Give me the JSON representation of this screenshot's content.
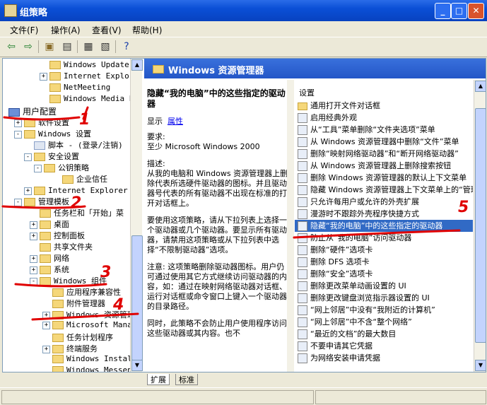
{
  "window": {
    "title": "组策略"
  },
  "menu": {
    "items": [
      "文件(F)",
      "操作(A)",
      "查看(V)",
      "帮助(H)"
    ]
  },
  "tree": {
    "rows": [
      {
        "label": "Windows Update",
        "indent": 66,
        "folder": true
      },
      {
        "label": "Internet Explor",
        "indent": 66,
        "folder": true,
        "expander": "+"
      },
      {
        "label": "NetMeeting",
        "indent": 66,
        "folder": true
      },
      {
        "label": "Windows Media Pl",
        "indent": 66,
        "folder": true
      },
      {
        "label": "用户配置",
        "indent": 8,
        "folder": false,
        "user": true
      },
      {
        "label": "软件设置",
        "indent": 30,
        "folder": true,
        "expander": "+"
      },
      {
        "label": "Windows 设置",
        "indent": 30,
        "folder": true,
        "expander": "-"
      },
      {
        "label": "脚本 - (登录/注销)",
        "indent": 44,
        "folder": false
      },
      {
        "label": "安全设置",
        "indent": 44,
        "folder": true,
        "expander": "-"
      },
      {
        "label": "公钥策略",
        "indent": 58,
        "folder": true,
        "expander": "-"
      },
      {
        "label": "企业信任",
        "indent": 84,
        "folder": true
      },
      {
        "label": "Internet Explorer 维",
        "indent": 44,
        "folder": true,
        "expander": "+"
      },
      {
        "label": "管理模板",
        "indent": 30,
        "folder": true,
        "expander": "-"
      },
      {
        "label": "任务栏和「开始」菜",
        "indent": 52,
        "folder": true
      },
      {
        "label": "桌面",
        "indent": 52,
        "folder": true,
        "expander": "+"
      },
      {
        "label": "控制面板",
        "indent": 52,
        "folder": true,
        "expander": "+"
      },
      {
        "label": "共享文件夹",
        "indent": 52,
        "folder": true
      },
      {
        "label": "网络",
        "indent": 52,
        "folder": true,
        "expander": "+"
      },
      {
        "label": "系统",
        "indent": 52,
        "folder": true,
        "expander": "+"
      },
      {
        "label": "Windows 组件",
        "indent": 52,
        "folder": true,
        "expander": "-"
      },
      {
        "label": "应用程序兼容性",
        "indent": 70,
        "folder": true
      },
      {
        "label": "附件管理器",
        "indent": 70,
        "folder": true
      },
      {
        "label": "Windows 资源管理",
        "indent": 70,
        "folder": true,
        "expander": "+"
      },
      {
        "label": "Microsoft Manag",
        "indent": 70,
        "folder": true,
        "expander": "+"
      },
      {
        "label": "任务计划程序",
        "indent": 70,
        "folder": true
      },
      {
        "label": "终端服务",
        "indent": 70,
        "folder": true,
        "expander": "+"
      },
      {
        "label": "Windows Install",
        "indent": 70,
        "folder": true
      },
      {
        "label": "Windows Messeng",
        "indent": 70,
        "folder": true
      }
    ]
  },
  "pane": {
    "title": "Windows 资源管理器"
  },
  "description": {
    "title": "隐藏“我的电脑”中的这些指定的驱动器",
    "display_label": "显示",
    "properties_link": "属性",
    "requirement_label": "要求:",
    "requirement_value": "至少 Microsoft Windows 2000",
    "desc_label": "描述:",
    "para1": "从我的电脑和 Windows 资源管理器上删除代表所选硬件驱动器的图标。并且驱动器号代表的所有驱动器不出现在标准的打开对话框上。",
    "para2": "要使用这项策略，请从下拉列表上选择一个驱动器或几个驱动器。要显示所有驱动器，请禁用这项策略或从下拉列表中选择“不限制驱动器”选项。",
    "para3": "注意: 这项策略删除驱动器图标。用户仍可通过使用其它方式继续访问驱动器的内容，如：通过在映射网络驱动器对话框、运行对话框或命令窗口上键入一个驱动器的目录路径。",
    "para4": "同时，此策略不会防止用户使用程序访问这些驱动器或其内容。也不"
  },
  "settings": {
    "header": "设置",
    "items": [
      {
        "label": "通用打开文件对话框",
        "type": "folder"
      },
      {
        "label": "启用经典外观",
        "type": "setting"
      },
      {
        "label": "从“工具”菜单删除“文件夹选项”菜单",
        "type": "setting"
      },
      {
        "label": "从 Windows 资源管理器中删除“文件”菜单",
        "type": "setting"
      },
      {
        "label": "删除“映射网络驱动器”和“断开网络驱动器”",
        "type": "setting"
      },
      {
        "label": "从 Windows 资源管理器上删除搜索按钮",
        "type": "setting"
      },
      {
        "label": "删除 Windows 资源管理器的默认上下文菜单",
        "type": "setting"
      },
      {
        "label": "隐藏 Windows 资源管理器上下文菜单上的“管理”",
        "type": "setting"
      },
      {
        "label": "只允许每用户或允许的外壳扩展",
        "type": "setting"
      },
      {
        "label": "漫游时不跟踪外壳程序快捷方式",
        "type": "setting"
      },
      {
        "label": "隐藏“我的电脑”中的这些指定的驱动器",
        "type": "setting",
        "selected": true
      },
      {
        "label": "防止从“我的电脑”访问驱动器",
        "type": "setting"
      },
      {
        "label": "删除“硬件”选项卡",
        "type": "setting"
      },
      {
        "label": "删除 DFS 选项卡",
        "type": "setting"
      },
      {
        "label": "删除“安全”选项卡",
        "type": "setting"
      },
      {
        "label": "删除更改菜单动画设置的 UI",
        "type": "setting"
      },
      {
        "label": "删除更改键盘浏览指示器设置的 UI",
        "type": "setting"
      },
      {
        "label": "“网上邻居”中没有“我附近的计算机”",
        "type": "setting"
      },
      {
        "label": "“网上邻居”中不含“整个网络”",
        "type": "setting"
      },
      {
        "label": "“最近的文档”的最大数目",
        "type": "setting"
      },
      {
        "label": "不要申请其它凭据",
        "type": "setting"
      },
      {
        "label": "为网络安装申请凭据",
        "type": "setting"
      }
    ]
  },
  "tabs": [
    "扩展",
    "标准"
  ],
  "annotations": {
    "color": "#e00000",
    "numbers": [
      "1",
      "2",
      "3",
      "4",
      "5"
    ]
  }
}
